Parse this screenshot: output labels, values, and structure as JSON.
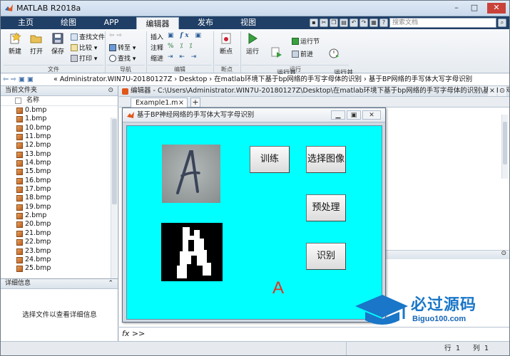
{
  "window": {
    "title": "MATLAB R2018a"
  },
  "ribbon_tabs": [
    "主页",
    "绘图",
    "APP",
    "编辑器",
    "发布",
    "视图"
  ],
  "search": {
    "placeholder": "搜索文档"
  },
  "ribbon": {
    "new": "新建",
    "open": "打开",
    "save": "保存",
    "find_files": "查找文件",
    "compare": "比较",
    "print": "打印",
    "goto": "转至",
    "find": "查找",
    "insert": "插入",
    "comment": "注释",
    "indent": "缩进",
    "breakpoints": "断点",
    "run": "运行",
    "run_advance": "运行并\n前进",
    "run_section": "运行节",
    "advance": "前进",
    "run_time": "运行并\n计时",
    "groups": {
      "file": "文件",
      "navigate": "导航",
      "edit": "编辑",
      "breakpoints": "断点",
      "run": "运行"
    }
  },
  "address": {
    "path": "« Administrator.WIN7U-20180127Z  ›  Desktop  ›  在matlab环境下基于bp网络的手写字母体的识别  ›  基于BP网络的手写体大写字母识别"
  },
  "current_folder": {
    "header": "当前文件夹",
    "column": "名称",
    "files": [
      "0.bmp",
      "1.bmp",
      "10.bmp",
      "11.bmp",
      "12.bmp",
      "13.bmp",
      "14.bmp",
      "15.bmp",
      "16.bmp",
      "17.bmp",
      "18.bmp",
      "19.bmp",
      "2.bmp",
      "20.bmp",
      "21.bmp",
      "22.bmp",
      "23.bmp",
      "24.bmp",
      "25.bmp"
    ]
  },
  "details": {
    "header": "详细信息",
    "message": "选择文件以查看详细信息"
  },
  "editor": {
    "header": "编辑器 - C:\\Users\\Administrator.WIN7U-20180127Z\\Desktop\\在matlab环境下基于bp网络的手写字母体的识别\\基于BP网络",
    "tab": "Example1.m"
  },
  "figure": {
    "title": "基于BP神经网络的手写体大写字母识别",
    "buttons": {
      "train": "训练",
      "select_image": "选择图像",
      "preprocess": "预处理",
      "recognize": "识别"
    },
    "result": "A"
  },
  "command": {
    "prompt": "fx >>"
  },
  "status": {
    "row_label": "行",
    "row": "1",
    "col_label": "列",
    "col": "1"
  },
  "watermark": {
    "name": "必过源码",
    "url": "Biguo100.com"
  }
}
